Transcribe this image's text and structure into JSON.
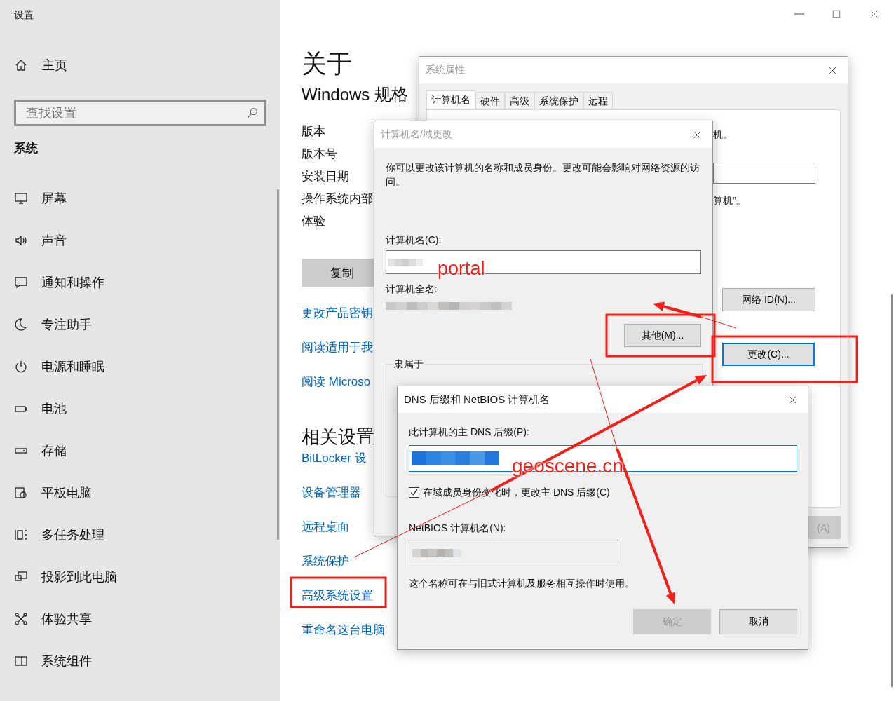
{
  "window": {
    "title": "设置"
  },
  "sidebar": {
    "home": "主页",
    "search": {
      "placeholder": "查找设置"
    },
    "section": "系统",
    "items": [
      {
        "label": "屏幕"
      },
      {
        "label": "声音"
      },
      {
        "label": "通知和操作"
      },
      {
        "label": "专注助手"
      },
      {
        "label": "电源和睡眠"
      },
      {
        "label": "电池"
      },
      {
        "label": "存储"
      },
      {
        "label": "平板电脑"
      },
      {
        "label": "多任务处理"
      },
      {
        "label": "投影到此电脑"
      },
      {
        "label": "体验共享"
      },
      {
        "label": "系统组件"
      }
    ]
  },
  "about": {
    "title": "关于",
    "subtitle": "Windows 规格",
    "spec_labels": [
      "版本",
      "版本号",
      "安装日期",
      "操作系统内部",
      "体验"
    ],
    "copy_button": "复制",
    "links": [
      "更改产品密钥",
      "阅读适用于我",
      "阅读 Microso"
    ],
    "related_title": "相关设置",
    "related_links": [
      "BitLocker 设",
      "设备管理器",
      "远程桌面",
      "系统保护",
      "高级系统设置",
      "重命名这台电脑"
    ]
  },
  "system_properties": {
    "title": "系统属性",
    "tabs": [
      {
        "label": "计算机名",
        "selected": true
      },
      {
        "label": "硬件",
        "selected": false
      },
      {
        "label": "高级",
        "selected": false
      },
      {
        "label": "系统保护",
        "selected": false
      },
      {
        "label": "远程",
        "selected": false
      }
    ],
    "text_fragments": [
      "机。",
      "算机”。"
    ],
    "network_id_button": "网络 ID(N)...",
    "change_button": "更改(C)...",
    "apply_button": {
      "label": "(A)",
      "disabled": true
    }
  },
  "name_change_dialog": {
    "title": "计算机名/域更改",
    "description": "你可以更改该计算机的名称和成员身份。更改可能会影响对网络资源的访问。",
    "computer_name_label": "计算机名(C):",
    "full_name_label": "计算机全名:",
    "more_button": "其他(M)...",
    "member_of_label": "隶属于"
  },
  "dns_dialog": {
    "title": "DNS 后缀和 NetBIOS 计算机名",
    "suffix_label": "此计算机的主 DNS 后缀(P):",
    "change_suffix": {
      "label": "在域成员身份变化时，更改主 DNS 后缀(C)",
      "checked": true
    },
    "netbios_label": "NetBIOS 计算机名(N):",
    "note": "这个名称可在与旧式计算机及服务相互操作时使用。",
    "buttons": [
      {
        "label": "确定",
        "disabled": true
      },
      {
        "label": "取消",
        "disabled": false
      }
    ]
  },
  "annotations": [
    "portal",
    "geoscene.cn"
  ]
}
